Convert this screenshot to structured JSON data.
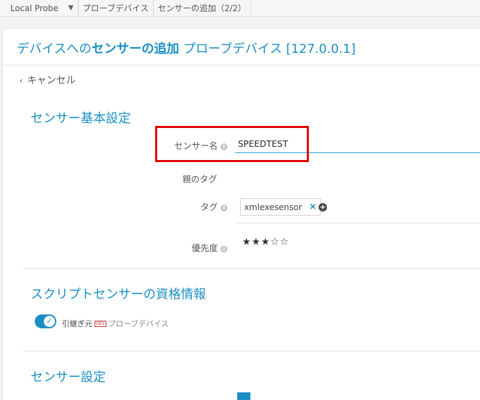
{
  "breadcrumb": {
    "items": [
      "Local Probe",
      "プローブデバイス",
      "センサーの追加（2/2）"
    ]
  },
  "page": {
    "title_prefix": "デバイスへの",
    "title_strong": "センサーの追加",
    "title_suffix": " プローブデバイス [127.0.0.1]",
    "cancel_label": "キャンセル"
  },
  "basic": {
    "title": "センサー基本設定",
    "name_label": "センサー名",
    "name_value": "SPEEDTEST",
    "parent_tag_label": "親のタグ",
    "tags_label": "タグ",
    "tag_chip": "xmlexesensor",
    "priority_label": "優先度",
    "priority_value": 3,
    "priority_max": 5
  },
  "credentials": {
    "title": "スクリプトセンサーの資格情報",
    "inherit_label": "引継ぎ元",
    "inherit_badge": "DEV",
    "inherit_source": "プローブデバイス",
    "inherit_enabled": true
  },
  "sensor_settings": {
    "title": "センサー設定"
  },
  "icons": {
    "info": "i",
    "chevron": "‹",
    "caret": "▼",
    "remove": "×",
    "add": "+",
    "check": "✓",
    "star_filled": "★",
    "star_empty": "☆"
  },
  "colors": {
    "accent": "#1a8fc4",
    "highlight": "#e30000"
  }
}
